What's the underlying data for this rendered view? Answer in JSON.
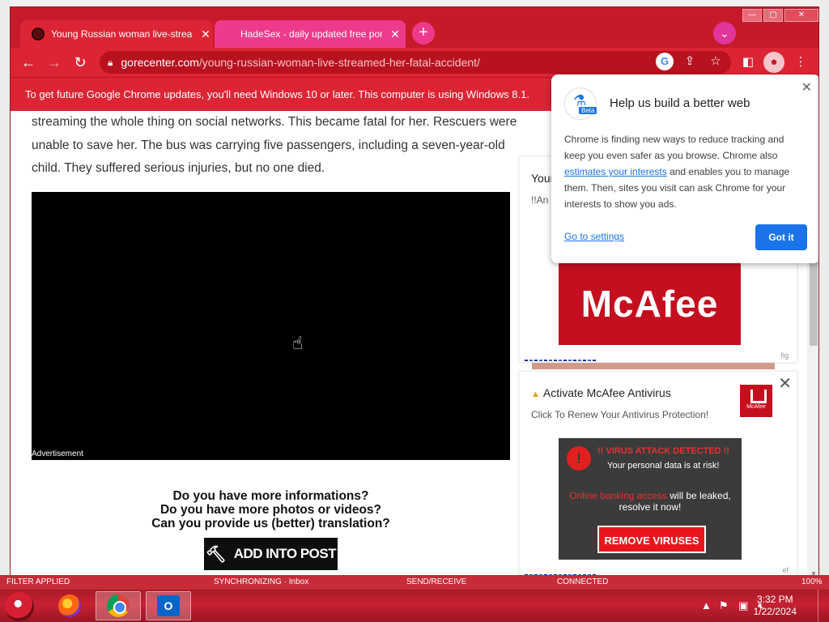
{
  "browser": {
    "tabs": [
      {
        "title": "Young Russian woman live-streamed her fatal accident",
        "close": "✕"
      },
      {
        "title": "HadeSex - daily updated free porn",
        "close": "✕"
      }
    ],
    "new_tab": "+",
    "tab_search": "⌄",
    "window_controls": {
      "minimize": "—",
      "maximize": "▢",
      "close": "✕"
    },
    "nav": {
      "back": "←",
      "forward": "→",
      "reload": "↻"
    },
    "url": {
      "domain": "gorecenter.com",
      "path": "/young-russian-woman-live-streamed-her-fatal-accident/"
    },
    "omnibox_icons": {
      "google": "G",
      "share": "⇪",
      "bookmark": "☆"
    },
    "toolbar_icons": {
      "sidepanel": "◧",
      "profile": "●",
      "menu": "⋮"
    },
    "infobar": "To get future Google Chrome updates, you'll need Windows 10 or later. This computer is using Windows 8.1."
  },
  "page": {
    "article_text": "streaming the whole thing on social networks. This became fatal for her. Rescuers were unable to save her. The bus was carrying five passengers, including a seven-year-old child. They suffered serious injuries, but no one died.",
    "video_ad_label": "Advertisement",
    "questions": [
      "Do you have more informations?",
      "Do you have more photos or videos?",
      "Can you provide us (better) translation?"
    ],
    "add_post_button": "ADD INTO POST"
  },
  "sidebar": {
    "card1": {
      "title": "Your",
      "subtitle": "!!An",
      "banner": "McAfee",
      "ad_mark": "fig"
    },
    "card2": {
      "title": "Activate McAfee Antivirus",
      "subtitle": "Click To Renew Your Antivirus Protection!",
      "logo_text": "McAfee",
      "close": "✕",
      "virus_head": "!! VIRUS ATTACK DETECTED !!",
      "virus_sub": "Your personal data is at risk!",
      "virus_mid_red": "Online banking access",
      "virus_mid": "will be leaked, resolve it now!",
      "remove_button": "REMOVE VIRUSES",
      "ad_mark": "ef"
    }
  },
  "privacy_bubble": {
    "title": "Help us build a better web",
    "beta_tag": "Beta",
    "close": "✕",
    "body_1": "Chrome is finding new ways to reduce tracking and keep you even safer as you browse. Chrome also",
    "body_link": "estimates your interests",
    "body_2": "and enables you to manage them. Then, sites you visit can ask Chrome for your interests to show you ads.",
    "settings_link": "Go to settings",
    "got_it": "Got it"
  },
  "outlook_status": {
    "filter": "FILTER APPLIED",
    "sync": "SYNCHRONIZING · Inbox",
    "send": "SEND/RECEIVE",
    "connected": "CONNECTED",
    "zoom": "100%"
  },
  "taskbar": {
    "time": "3:32 PM",
    "date": "1/22/2024",
    "outlook_letter": "O"
  },
  "colors": {
    "chrome_theme": "#dd2434",
    "taskbar": "#c72133",
    "accent_blue": "#1a73e8"
  }
}
